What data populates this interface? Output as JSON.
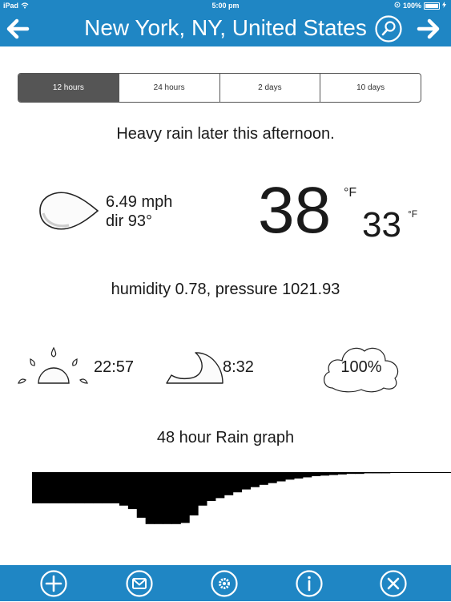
{
  "status_bar": {
    "device": "iPad",
    "time": "5:00 pm",
    "battery": "100%"
  },
  "navbar": {
    "title": "New York, NY, United States",
    "back_icon": "arrow-left-icon",
    "forward_icon": "arrow-right-icon",
    "search_icon": "search-icon"
  },
  "range_tabs": [
    {
      "label": "12 hours",
      "active": true
    },
    {
      "label": "24 hours",
      "active": false
    },
    {
      "label": "2 days",
      "active": false
    },
    {
      "label": "10 days",
      "active": false
    }
  ],
  "summary": "Heavy rain later this afternoon.",
  "wind": {
    "speed": "6.49 mph",
    "direction": "dir 93°"
  },
  "temperature": {
    "current": "38",
    "current_unit": "°F",
    "low": "33",
    "low_unit": "°F"
  },
  "atmosphere": "humidity 0.78, pressure 1021.93",
  "sun": {
    "time": "22:57"
  },
  "moon": {
    "time": "8:32"
  },
  "cloud": {
    "value": "100%"
  },
  "rain_graph": {
    "title": "48 hour Rain graph",
    "levels": [
      0.54,
      0.54,
      0.54,
      0.54,
      0.54,
      0.54,
      0.54,
      0.54,
      0.54,
      0.54,
      0.58,
      0.64,
      0.79,
      0.9,
      0.9,
      0.9,
      0.9,
      0.88,
      0.75,
      0.58,
      0.5,
      0.45,
      0.4,
      0.35,
      0.3,
      0.26,
      0.22,
      0.19,
      0.16,
      0.13,
      0.11,
      0.09,
      0.07,
      0.06,
      0.05,
      0.04,
      0.03,
      0.03,
      0.02,
      0.02,
      0.02,
      0.01,
      0.01,
      0.01,
      0.01,
      0.01,
      0.01,
      0.01
    ]
  },
  "toolbar": [
    {
      "icon": "add-icon"
    },
    {
      "icon": "mail-icon"
    },
    {
      "icon": "settings-icon"
    },
    {
      "icon": "info-icon"
    },
    {
      "icon": "close-icon"
    }
  ],
  "colors": {
    "bar_blue": "#1f86c4",
    "active_tab": "#555555"
  }
}
